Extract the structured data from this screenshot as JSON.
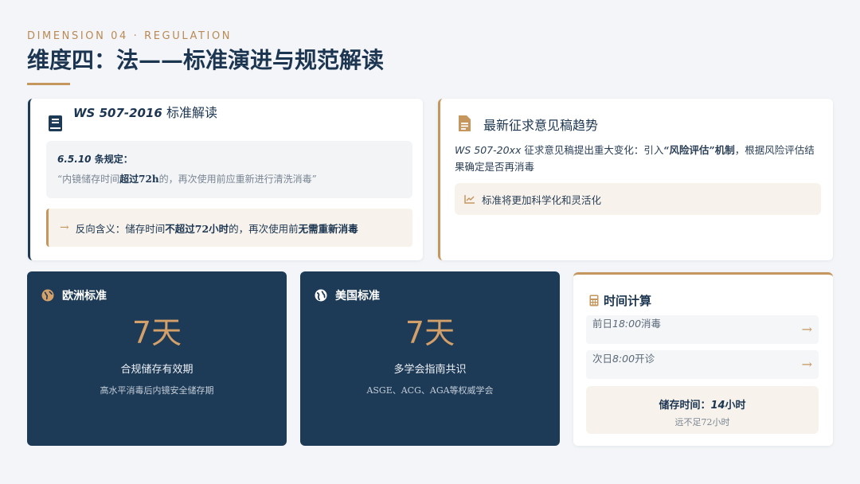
{
  "header": {
    "eyebrow": "DIMENSION 04 · REGULATION",
    "title": "维度四：法——标准演进与规范解读"
  },
  "standard_card": {
    "title_code": "WS 507-2016",
    "title_rest": " 标准解读",
    "quote_num": "6.5.10",
    "quote_label": " 条规定：",
    "quote_pre": "“内镜储存时间",
    "quote_bold": "超过72h",
    "quote_post": "的，再次使用前应重新进行清洗消毒”",
    "impl_label": "反向含义：储存时间",
    "impl_bold1": "不超过72小时",
    "impl_mid": "的，再次使用前",
    "impl_bold2": "无需重新消毒"
  },
  "draft_card": {
    "title": "最新征求意见稿趋势",
    "text_code": "WS 507-20xx",
    "text_pre": " 征求意见稿提出重大变化：引入",
    "text_bold": "“风险评估”机制",
    "text_post": "，根据风险评估结果确定是否再消毒",
    "trend": "标准将更加科学化和灵活化"
  },
  "eu_card": {
    "title": "欧洲标准",
    "value_num": "7",
    "value_unit": "天",
    "subtitle": "合规储存有效期",
    "note": "高水平消毒后内镜安全储存期"
  },
  "us_card": {
    "title": "美国标准",
    "value_num": "7",
    "value_unit": "天",
    "subtitle": "多学会指南共识",
    "note": "ASGE、ACG、AGA等权威学会"
  },
  "calc_card": {
    "title": "时间计算",
    "row1_pre": "前日",
    "row1_time": "18:00",
    "row1_post": "消毒",
    "row2_pre": "次日",
    "row2_time": "8:00",
    "row2_post": "开诊",
    "result_pre": "储存时间：",
    "result_num": "14",
    "result_post": "小时",
    "result_note": "远不足72小时"
  },
  "colors": {
    "navy": "#1d3a56",
    "gold": "#c5975f"
  }
}
